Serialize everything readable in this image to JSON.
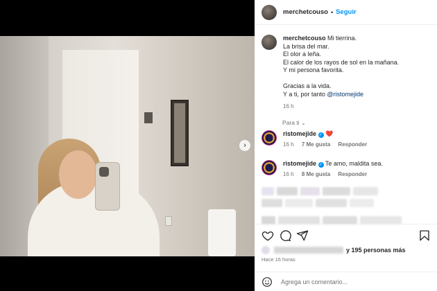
{
  "post": {
    "username": "merchetcouso",
    "follow_label": "Seguir",
    "separator": "•"
  },
  "caption": {
    "username": "merchetcouso",
    "first_line": "Mi tierrina.",
    "lines": [
      "La brisa del mar.",
      "El olor a leña.",
      "El calor de los rayos de sol en la mañana.",
      "Y mi persona favorita."
    ],
    "line_thanks": "Gracias a la vida.",
    "line_last_prefix": "Y a ti, por tanto ",
    "mention": "@ristomejide",
    "time": "16 h"
  },
  "filter_label": "Para ti",
  "comments": [
    {
      "username": "ristomejide",
      "text": "❤️",
      "time": "16 h",
      "likes": "7 Me gusta",
      "reply": "Responder"
    },
    {
      "username": "ristomejide",
      "text": "Te amo, maldita sea.",
      "time": "16 h",
      "likes": "8 Me gusta",
      "reply": "Responder"
    }
  ],
  "likes": {
    "suffix": "y 195 personas más"
  },
  "posted_ago": "Hace 16 horas",
  "comment_input": {
    "placeholder": "Agrega un comentario..."
  },
  "icons": {
    "heart": "heart-icon",
    "comment": "comment-icon",
    "share": "share-icon",
    "save": "bookmark-icon",
    "emoji": "emoji-icon",
    "next": "chevron-right-icon"
  },
  "colors": {
    "link": "#0095f6",
    "text": "#262626",
    "muted": "#737373",
    "heart": "#ed4956"
  }
}
